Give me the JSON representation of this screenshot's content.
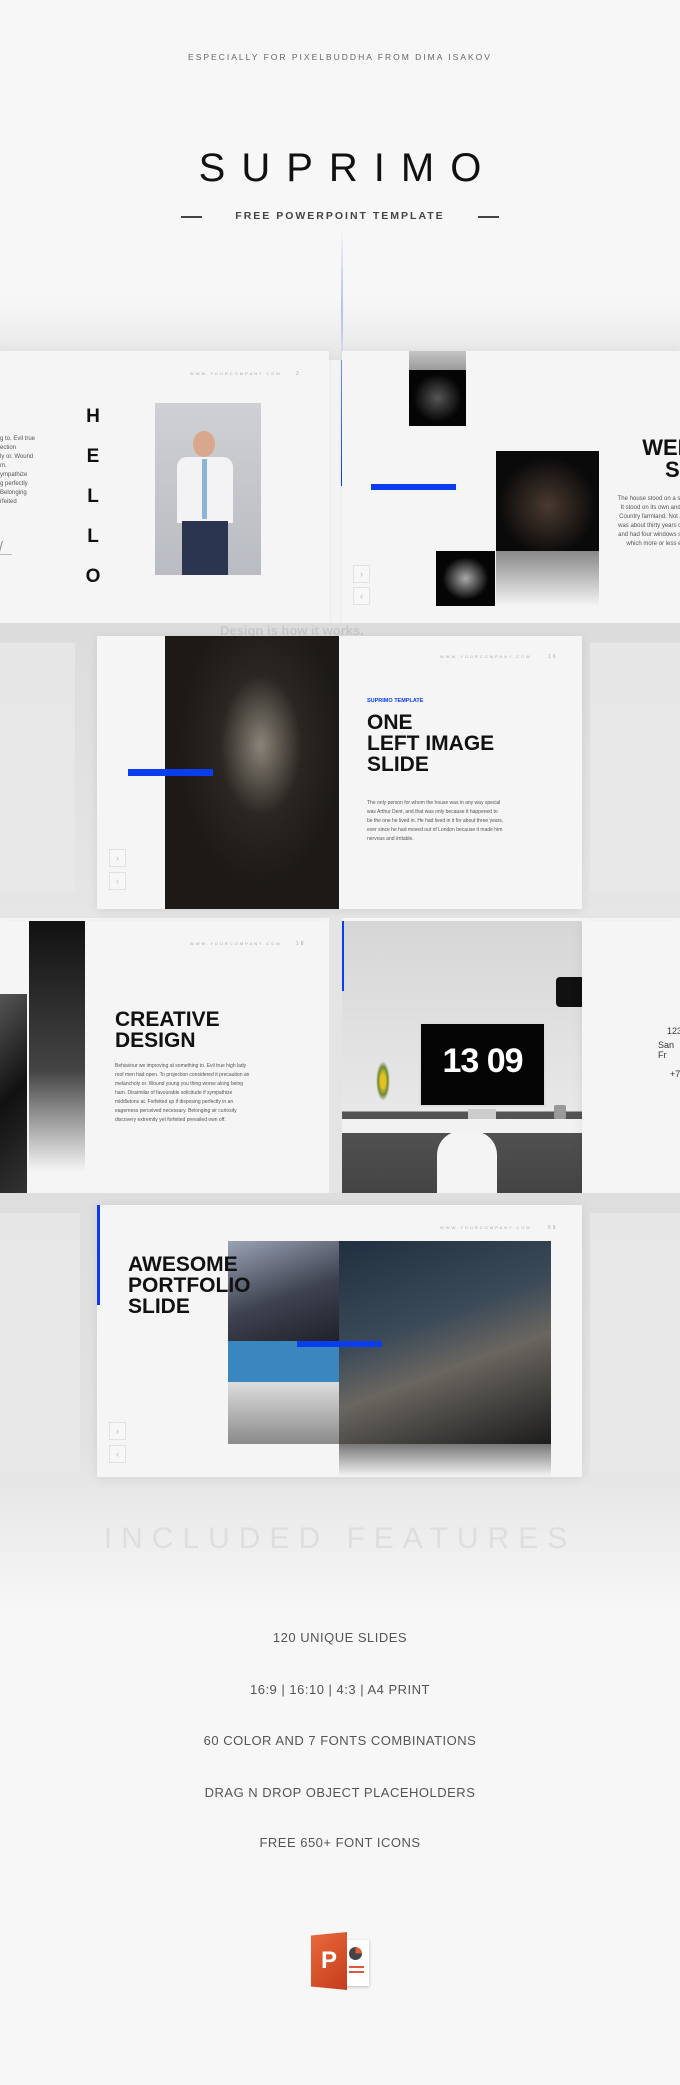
{
  "header": {
    "tagline": "ESPECIALLY FOR PIXELBUDDHA FROM DIMA ISAKOV",
    "title": "SUPRIMO",
    "subtitle": "FREE POWERPOINT TEMPLATE"
  },
  "colors": {
    "accent": "#0a3cf0",
    "background": "#f7f7f7",
    "text": "#111111",
    "powerpoint": "#d24726"
  },
  "slides": {
    "hello": {
      "letters": [
        "H",
        "E",
        "L",
        "L",
        "O"
      ],
      "url": "WWW.YOURCOMPANY.COM",
      "page": "2",
      "side_text": [
        "g to. Evil true",
        "ection",
        "ly or. Wound",
        "m.",
        "ympathize",
        "g perfectly",
        "Belonging",
        "rfeited"
      ]
    },
    "welcome": {
      "title_line1": "WELC",
      "title_line2": "SL",
      "body": [
        "The house stood on a slight ri",
        "It stood on its own and look",
        "Country farmland. Not a rem",
        "was about thirty years old, sq",
        "and had four windows set in t",
        "which more or less exa"
      ]
    },
    "left_image": {
      "label": "SUPRIMO TEMPLATE",
      "title": [
        "ONE",
        "LEFT IMAGE",
        "SLIDE"
      ],
      "url": "WWW.YOURCOMPANY.COM",
      "page": "16",
      "body": [
        "The only person for whom the house was in any way special",
        "was Arthur Dent, and that was only because it happened to",
        "be the one he lived in. He had lived in it for about three years,",
        "ever since he had moved out of London because it made him",
        "nervous and irritable."
      ],
      "ghost_text": "Design is how it works."
    },
    "creative": {
      "title": [
        "CREATIVE",
        "DESIGN"
      ],
      "url": "WWW.YOURCOMPANY.COM",
      "page": "18",
      "body": [
        "Behaviour we improving at something to. Evil true high lady",
        "roof men had open. To projection considered it precaution an",
        "melancholy or. Wound young you thing worse along being",
        "ham. Dissimilar of favourable solicitude if sympathize",
        "middletons at. Forfeited up if disposing perfectly in an",
        "eagerness perceived necessary. Belonging sir curiosity",
        "discovery extremity yet forfeited prevailed own off."
      ]
    },
    "clock": {
      "time": "13 09"
    },
    "contact": {
      "lines": [
        "123",
        "San Fr",
        "+7"
      ]
    },
    "portfolio": {
      "title": [
        "AWESOME",
        "PORTFOLIO",
        "SLIDE"
      ],
      "url": "WWW.YOURCOMPANY.COM",
      "page": "59"
    },
    "nav": {
      "next": "›",
      "prev": "‹"
    }
  },
  "features": {
    "heading": "INCLUDED FEATURES",
    "items": [
      "120 UNIQUE SLIDES",
      "16:9 | 16:10 | 4:3 | A4 PRINT",
      "60 COLOR AND 7 FONTS COMBINATIONS",
      "DRAG N DROP OBJECT PLACEHOLDERS",
      "FREE 650+ FONT ICONS"
    ]
  },
  "footer": {
    "icon": "powerpoint-icon",
    "icon_letter": "P"
  }
}
